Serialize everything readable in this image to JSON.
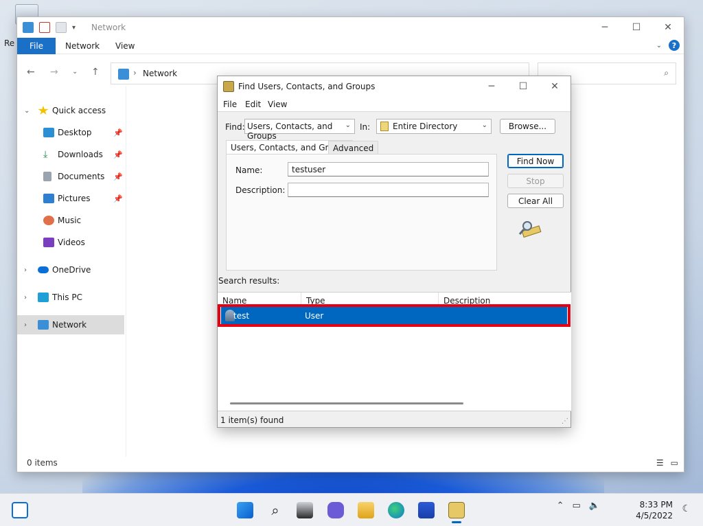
{
  "desktop": {
    "icon_label": "Re"
  },
  "explorer": {
    "title": "Network",
    "ribbon": {
      "file": "File",
      "tabs": [
        "Network",
        "View"
      ]
    },
    "address": "Network",
    "sidebar": [
      {
        "label": "Quick access",
        "icon": "star-icon"
      },
      {
        "label": "Desktop",
        "icon": "desktop-icon"
      },
      {
        "label": "Downloads",
        "icon": "download-icon"
      },
      {
        "label": "Documents",
        "icon": "documents-icon"
      },
      {
        "label": "Pictures",
        "icon": "pictures-icon"
      },
      {
        "label": "Music",
        "icon": "music-icon"
      },
      {
        "label": "Videos",
        "icon": "videos-icon"
      },
      {
        "label": "OneDrive",
        "icon": "onedrive-icon"
      },
      {
        "label": "This PC",
        "icon": "pc-icon"
      },
      {
        "label": "Network",
        "icon": "network-icon"
      }
    ],
    "status": "0 items"
  },
  "dialog": {
    "title": "Find Users, Contacts, and Groups",
    "menu": [
      "File",
      "Edit",
      "View"
    ],
    "find_label": "Find:",
    "find_value": "Users, Contacts, and Groups",
    "in_label": "In:",
    "in_value": "Entire Directory",
    "browse": "Browse...",
    "tabs": [
      "Users, Contacts, and Groups",
      "Advanced"
    ],
    "name_label": "Name:",
    "name_value": "testuser",
    "description_label": "Description:",
    "description_value": "",
    "find_now": "Find Now",
    "stop": "Stop",
    "clear_all": "Clear All",
    "results_label": "Search results:",
    "columns": [
      "Name",
      "Type",
      "Description"
    ],
    "rows": [
      {
        "name": "test",
        "type": "User",
        "description": ""
      }
    ],
    "status": "1 item(s) found"
  },
  "taskbar": {
    "time": "8:33 PM",
    "date": "4/5/2022"
  },
  "colors": {
    "accent": "#0067c0",
    "highlight": "#e60012"
  }
}
